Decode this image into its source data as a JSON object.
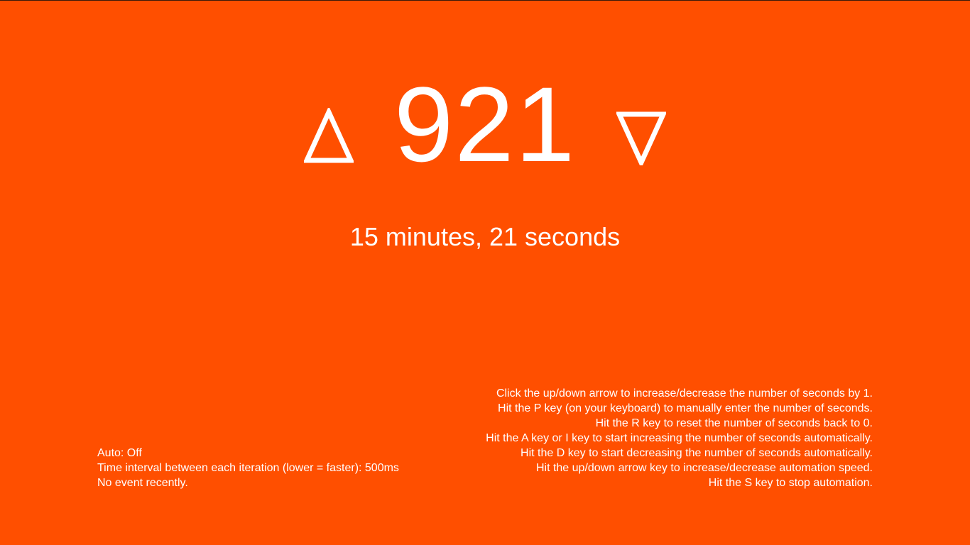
{
  "page": {
    "background_color": "#FF4F00",
    "text_color": "#FFFFFF"
  },
  "counter": {
    "up_icon": "up-triangle-icon",
    "down_icon": "down-triangle-icon",
    "seconds": "921",
    "human_readable": "15 minutes, 21 seconds"
  },
  "status": {
    "auto": "Auto: Off",
    "interval": "Time interval between each iteration (lower = faster): 500ms",
    "event": "No event recently."
  },
  "help": {
    "lines": [
      "Click the up/down arrow to increase/decrease the number of seconds by 1.",
      "Hit the P key (on your keyboard) to manually enter the number of seconds.",
      "Hit the R key to reset the number of seconds back to 0.",
      "Hit the A key or I key to start increasing the number of seconds automatically.",
      "Hit the D key to start decreasing the number of seconds automatically.",
      "Hit the up/down arrow key to increase/decrease automation speed.",
      "Hit the S key to stop automation."
    ]
  }
}
